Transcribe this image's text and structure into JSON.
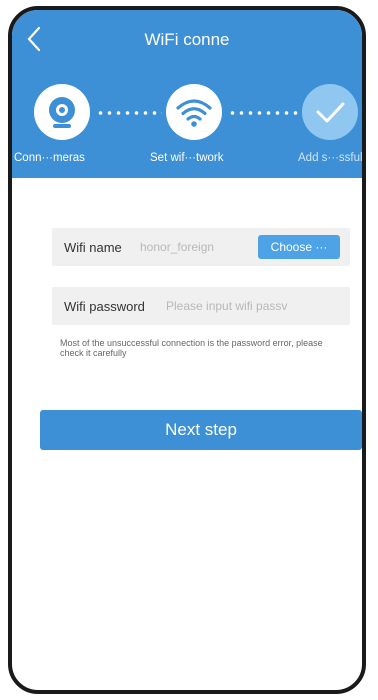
{
  "header": {
    "title": "WiFi conne",
    "back_icon": "back-chevron-icon",
    "background": "#3d8fd6"
  },
  "steps": [
    {
      "label": "Conn···meras",
      "icon": "camera-icon",
      "state": "done"
    },
    {
      "label": "Set wif···twork",
      "icon": "wifi-icon",
      "state": "active"
    },
    {
      "label": "Add s···ssfully",
      "icon": "check-icon",
      "state": "pending"
    }
  ],
  "wifi_name": {
    "label": "Wifi name",
    "value": "honor_foreign",
    "choose_label": "Choose ···"
  },
  "wifi_password": {
    "label": "Wifi password",
    "placeholder": "Please input wifi passv"
  },
  "hint": "Most of the unsuccessful connection is the password error, please check it carefully",
  "next_button": "Next step",
  "colors": {
    "accent": "#3d8fd6",
    "button": "#4ea3e6",
    "pending_step": "#8fc7f0"
  }
}
